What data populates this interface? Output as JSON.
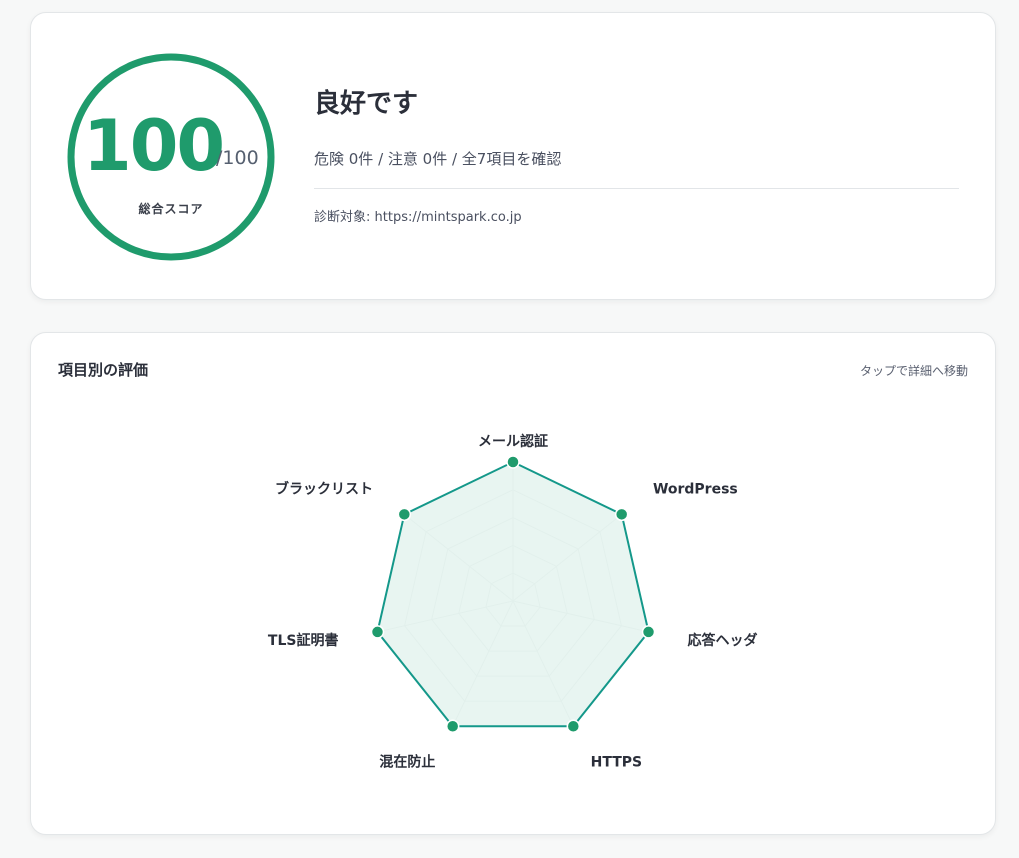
{
  "summary": {
    "score": "100",
    "score_max": "/100",
    "score_caption": "総合スコア",
    "score_fraction": 1.0,
    "verdict": "良好です",
    "counts": "危険 0件 / 注意 0件 / 全7項目を確認",
    "target": "診断対象: https://mintspark.co.jp"
  },
  "radar": {
    "title": "項目別の評価",
    "hint": "タップで詳細へ移動",
    "accent_color": "#1f9b6c",
    "line_color": "#14988a",
    "fill_color": "#e4f3ef",
    "grid_color": "#d6dcdb",
    "levels": 5,
    "max": 100,
    "axes": [
      {
        "label": "メール認証",
        "value": 100
      },
      {
        "label": "WordPress",
        "value": 100
      },
      {
        "label": "応答ヘッダ",
        "value": 100
      },
      {
        "label": "HTTPS",
        "value": 100
      },
      {
        "label": "混在防止",
        "value": 100
      },
      {
        "label": "TLS証明書",
        "value": 100
      },
      {
        "label": "ブラックリスト",
        "value": 100
      }
    ]
  }
}
